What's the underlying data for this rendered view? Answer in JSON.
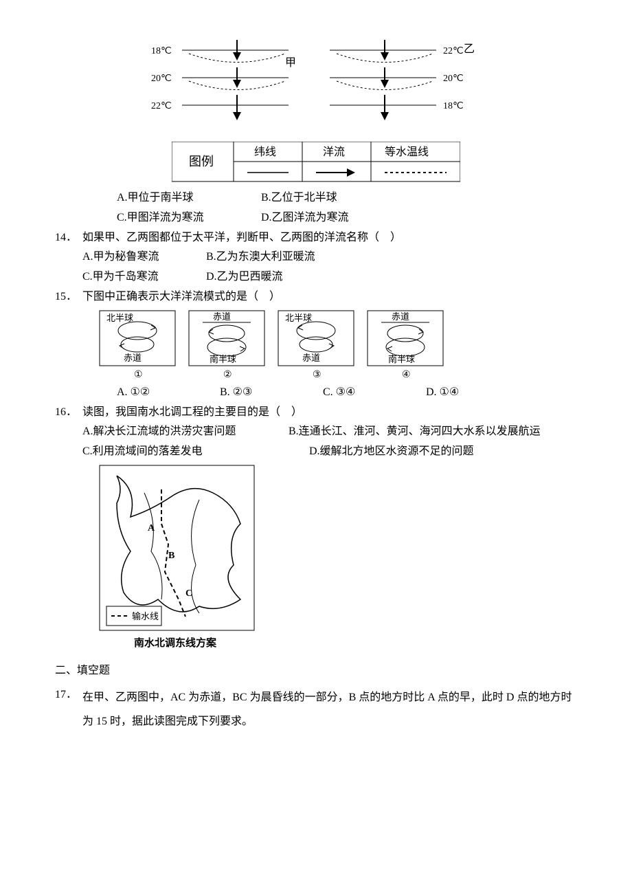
{
  "figure_top": {
    "left": {
      "temps": [
        "18℃",
        "20℃",
        "22℃"
      ],
      "label": "甲"
    },
    "right": {
      "temps": [
        "22℃",
        "20℃",
        "18℃"
      ],
      "label": "乙"
    },
    "legend": {
      "title": "图例",
      "cols": [
        "纬线",
        "洋流",
        "等水温线"
      ]
    }
  },
  "q13": {
    "A": "A.甲位于南半球",
    "B": "B.乙位于北半球",
    "C": "C.甲图洋流为寒流",
    "D": "D.乙图洋流为寒流"
  },
  "q14": {
    "num": "14．",
    "stem_pre": "如果甲、乙两图都位于太平洋，判断甲、乙两图的洋流名称（",
    "stem_post": "）",
    "A": "A.甲为秘鲁寒流",
    "B": "B.乙为东澳大利亚暖流",
    "C": "C.甲为千岛寒流",
    "D": "D.乙为巴西暖流"
  },
  "q15": {
    "num": "15．",
    "stem_pre": "下图中正确表示大洋洋流模式的是（",
    "stem_post": "）",
    "fig_labels": {
      "n": "北半球",
      "s": "南半球",
      "eq": "赤道",
      "n1": "①",
      "n2": "②",
      "n3": "③",
      "n4": "④"
    },
    "A": "A.  ①②",
    "B": "B. ②③",
    "C": "C. ③④",
    "D": "D.  ①④"
  },
  "q16": {
    "num": "16．",
    "stem_pre": "读图，我国南水北调工程的主要目的是（",
    "stem_post": "）",
    "A": "A.解决长江流域的洪涝灾害问题",
    "B": "B.连通长江、淮河、黄河、海河四大水系以发展航运",
    "C": "C.利用流域间的落差发电",
    "D": "D.缓解北方地区水资源不足的问题",
    "map": {
      "legend": "输水线",
      "caption": "南水北调东线方案",
      "marks": [
        "A",
        "B",
        "C"
      ]
    }
  },
  "section2": "二、填空题",
  "q17": {
    "num": "17．",
    "stem": "在甲、乙两图中，AC 为赤道，BC 为晨昏线的一部分，B 点的地方时比 A 点的早，此时 D 点的地方时为 15 时，据此读图完成下列要求。"
  }
}
